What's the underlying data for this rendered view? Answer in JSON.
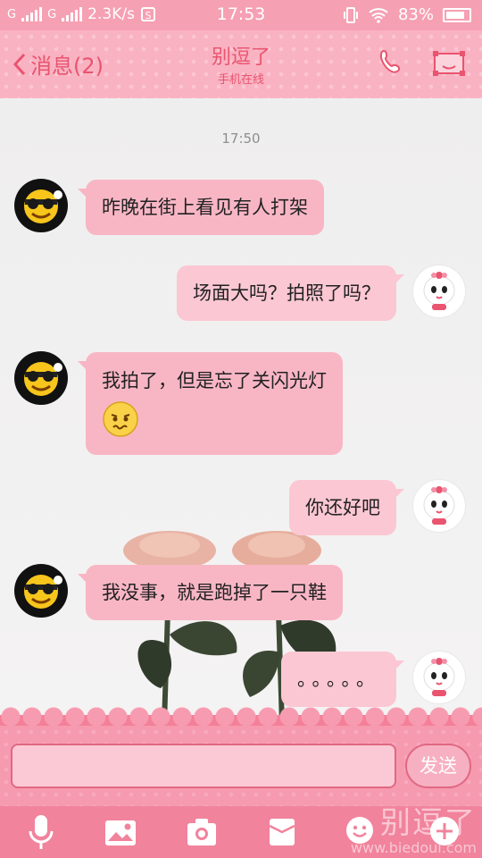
{
  "status_bar": {
    "carrier1": "G",
    "carrier2": "G",
    "speed": "2.3K/s",
    "time": "17:53",
    "battery": "83%"
  },
  "header": {
    "back_label": "消息(2)",
    "title": "别逗了",
    "subtitle": "手机在线",
    "icons": [
      "phone-icon",
      "profile-icon"
    ]
  },
  "chat": {
    "timestamp": "17:50",
    "messages": [
      {
        "side": "in",
        "text": "昨晚在街上看见有人打架"
      },
      {
        "side": "out",
        "text": "场面大吗？拍照了吗？"
      },
      {
        "side": "in",
        "text": "我拍了，但是忘了关闪光灯",
        "emoji": "embarrassed-emoji"
      },
      {
        "side": "out",
        "text": "你还好吧"
      },
      {
        "side": "in",
        "text": "我没事，就是跑掉了一只鞋"
      },
      {
        "side": "out",
        "text": "。。。。。"
      }
    ]
  },
  "input": {
    "placeholder": "",
    "send_label": "发送"
  },
  "toolbar": {
    "icons": [
      "microphone-icon",
      "image-icon",
      "camera-icon",
      "envelope-icon",
      "emoji-icon",
      "plus-icon"
    ]
  },
  "watermark": {
    "title": "别逗了",
    "url": "www.biedoul.com"
  },
  "colors": {
    "accent": "#e9546f",
    "header_bg": "#f9b2c2",
    "bubble_in": "#f8b6c5",
    "bubble_out": "#fbc7d3",
    "toolbar_bg": "#f1839c"
  }
}
